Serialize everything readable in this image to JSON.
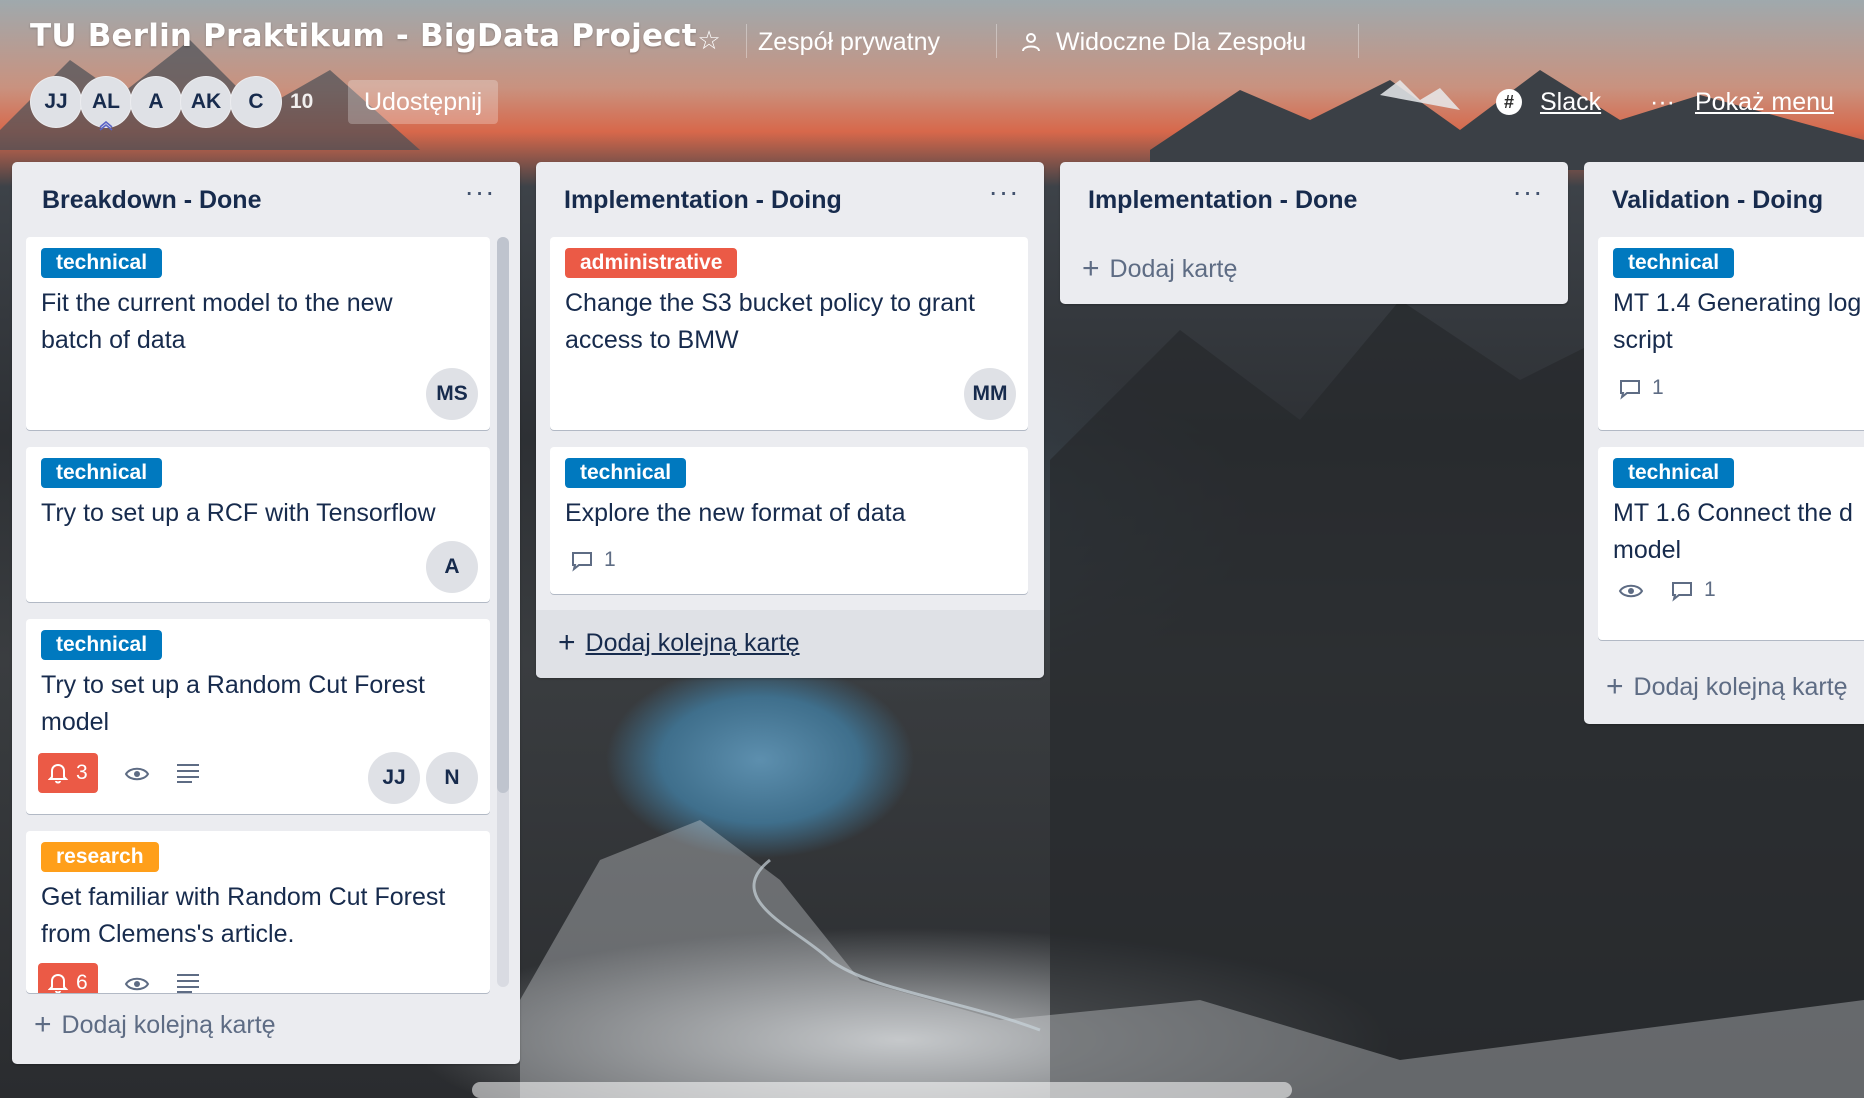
{
  "board": {
    "title": "TU Berlin Praktikum - BigData Project",
    "team": "Zespół prywatny",
    "visibility": "Widoczne Dla Zespołu",
    "members": [
      "JJ",
      "AL",
      "A",
      "AK",
      "C"
    ],
    "member_count": "10",
    "share_label": "Udostępnij",
    "slack_label": "Slack",
    "menu_label": "Pokaż menu"
  },
  "lists": [
    {
      "title": "Breakdown - Done",
      "cards": [
        {
          "label": "technical",
          "title_lines": [
            "Fit the current model to the new",
            "batch of data"
          ],
          "members": [
            "MS"
          ]
        },
        {
          "label": "technical",
          "title_lines": [
            "Try to set up a RCF with Tensorflow"
          ],
          "members": [
            "A"
          ]
        },
        {
          "label": "technical",
          "title_lines": [
            "Try to set up a Random Cut Forest",
            "model"
          ],
          "notifications": "3",
          "members": [
            "JJ",
            "N"
          ]
        },
        {
          "label": "research",
          "title_lines": [
            "Get familiar with Random Cut Forest",
            "from Clemens's article."
          ],
          "notifications": "6"
        }
      ],
      "add_label": "Dodaj kolejną kartę"
    },
    {
      "title": "Implementation - Doing",
      "cards": [
        {
          "label": "administrative",
          "title_lines": [
            "Change the S3 bucket policy to grant",
            "access to BMW"
          ],
          "members": [
            "MM"
          ]
        },
        {
          "label": "technical",
          "title_lines": [
            "Explore the new format of data"
          ],
          "comments": "1"
        }
      ],
      "add_label": "Dodaj kolejną kartę"
    },
    {
      "title": "Implementation - Done",
      "cards": [],
      "add_label": "Dodaj kartę"
    },
    {
      "title": "Validation - Doing",
      "cards": [
        {
          "label": "technical",
          "title_lines": [
            "MT 1.4 Generating log",
            "script"
          ],
          "comments": "1"
        },
        {
          "label": "technical",
          "title_lines": [
            "MT 1.6 Connect the d",
            "model"
          ],
          "comments": "1"
        }
      ],
      "add_label": "Dodaj kolejną kartę"
    }
  ],
  "colors": {
    "label_technical": "#0079bf",
    "label_administrative": "#eb5a46",
    "label_research": "#ff9f1a",
    "list_bg": "#ebecf0",
    "text": "#172b4d"
  },
  "icons": [
    "star-icon",
    "team-icon",
    "slack-icon",
    "more-icon",
    "bell-icon",
    "eye-icon",
    "description-icon",
    "comment-icon",
    "plus-icon"
  ]
}
